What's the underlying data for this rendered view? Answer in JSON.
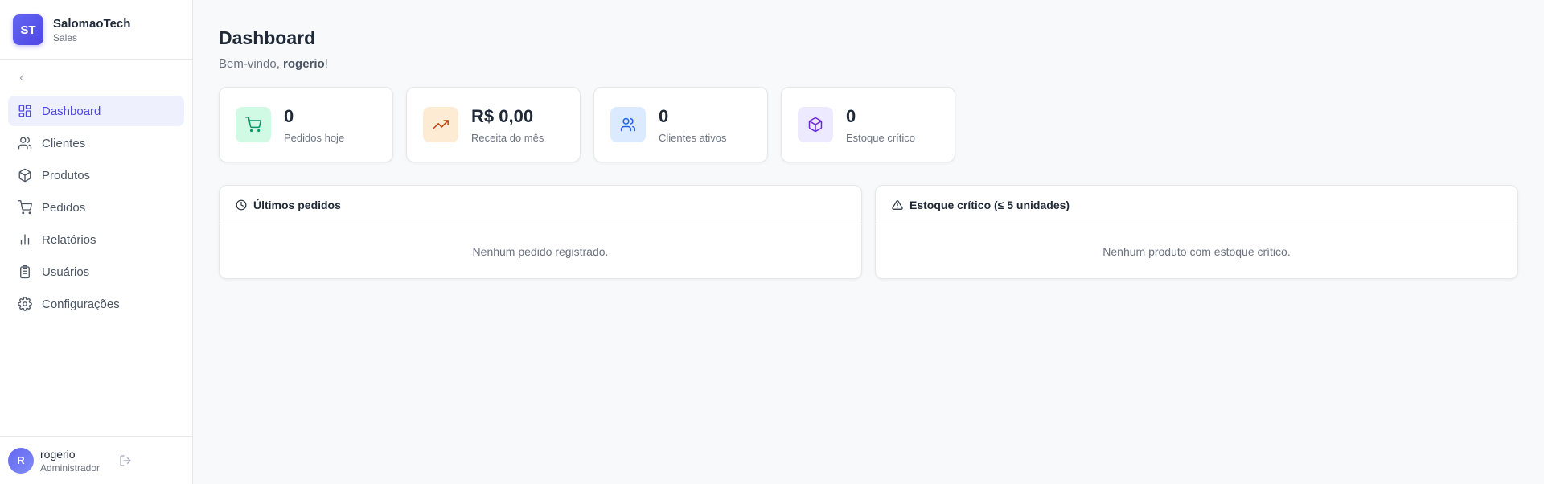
{
  "brand": {
    "initials": "ST",
    "name": "SalomaoTech",
    "subtitle": "Sales"
  },
  "sidebar": {
    "items": [
      {
        "label": "Dashboard",
        "icon": "dashboard-icon",
        "active": true
      },
      {
        "label": "Clientes",
        "icon": "users-icon"
      },
      {
        "label": "Produtos",
        "icon": "package-icon"
      },
      {
        "label": "Pedidos",
        "icon": "cart-icon"
      },
      {
        "label": "Relatórios",
        "icon": "bar-chart-icon"
      },
      {
        "label": "Usuários",
        "icon": "clipboard-icon"
      },
      {
        "label": "Configurações",
        "icon": "gear-icon"
      }
    ]
  },
  "user": {
    "initial": "R",
    "name": "rogerio",
    "role": "Administrador"
  },
  "header": {
    "title": "Dashboard",
    "welcome_prefix": "Bem-vindo, ",
    "welcome_name": "rogerio",
    "welcome_suffix": "!"
  },
  "stats": [
    {
      "value": "0",
      "label": "Pedidos hoje",
      "icon": "cart-icon",
      "bg": "#d1fae5",
      "color": "#059669"
    },
    {
      "value": "R$ 0,00",
      "label": "Receita do mês",
      "icon": "trending-up-icon",
      "bg": "#fdebd3",
      "color": "#c2410c"
    },
    {
      "value": "0",
      "label": "Clientes ativos",
      "icon": "users-icon",
      "bg": "#dbeafe",
      "color": "#2563eb"
    },
    {
      "value": "0",
      "label": "Estoque crítico",
      "icon": "package-icon",
      "bg": "#ede9fe",
      "color": "#6d28d9"
    }
  ],
  "panels": [
    {
      "title": "Últimos pedidos",
      "icon": "clock-icon",
      "empty": "Nenhum pedido registrado."
    },
    {
      "title": "Estoque crítico (≤ 5 unidades)",
      "icon": "warning-icon",
      "empty": "Nenhum produto com estoque crítico."
    }
  ]
}
